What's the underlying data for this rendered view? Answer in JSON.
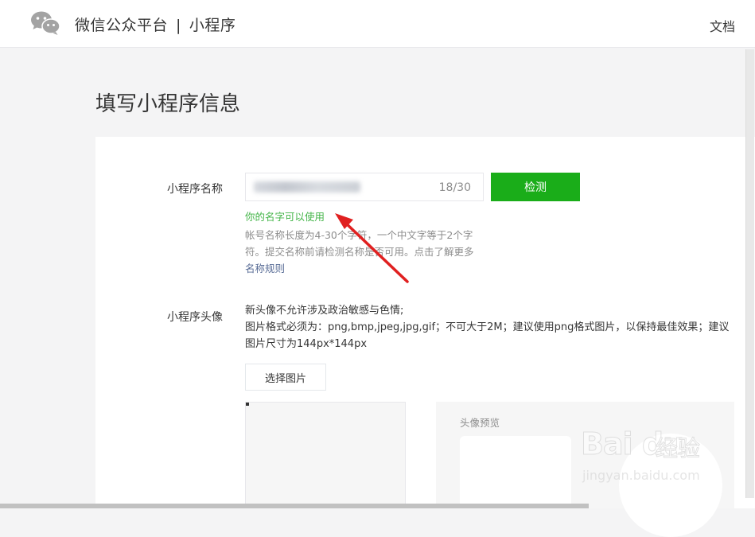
{
  "header": {
    "brand": "微信公众平台",
    "separator": "|",
    "section": "小程序",
    "docs_label": "文档"
  },
  "page": {
    "title": "填写小程序信息"
  },
  "name_field": {
    "label": "小程序名称",
    "value_obscured": true,
    "counter": "18/30",
    "check_button_label": "检测",
    "success_message": "你的名字可以使用",
    "tip_text": "帐号名称长度为4-30个字符，一个中文字等于2个字符。提交名称前请检测名称是否可用。点击了解更多",
    "tip_link": "名称规则"
  },
  "avatar_field": {
    "label": "小程序头像",
    "rule_line1": "新头像不允许涉及政治敏感与色情;",
    "rule_line2": "图片格式必须为：png,bmp,jpeg,jpg,gif；不可大于2M；建议使用png格式图片，以保持最佳效果；建议图片尺寸为144px*144px",
    "choose_button_label": "选择图片",
    "preview_label": "头像预览"
  },
  "watermark": {
    "logo_text": "Bai du",
    "logo_cn": "经验",
    "url": "jingyan.baidu.com"
  },
  "colors": {
    "brand_green": "#1aad19",
    "success_green": "#44b549",
    "link_blue": "#576b95",
    "annotation_red": "#e02020"
  }
}
